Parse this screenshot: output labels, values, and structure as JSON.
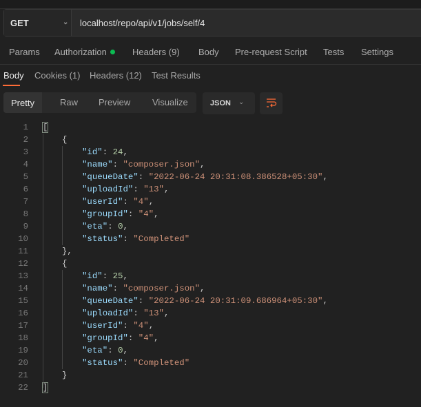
{
  "request": {
    "method": "GET",
    "url": "localhost/repo/api/v1/jobs/self/4"
  },
  "request_tabs": [
    {
      "label": "Params"
    },
    {
      "label": "Authorization",
      "indicator": "green-dot"
    },
    {
      "label": "Headers",
      "count": "(9)"
    },
    {
      "label": "Body"
    },
    {
      "label": "Pre-request Script"
    },
    {
      "label": "Tests"
    },
    {
      "label": "Settings"
    }
  ],
  "response_tabs": [
    {
      "label": "Body",
      "active": true
    },
    {
      "label": "Cookies",
      "count": "(1)"
    },
    {
      "label": "Headers",
      "count": "(12)"
    },
    {
      "label": "Test Results"
    }
  ],
  "view_modes": [
    "Pretty",
    "Raw",
    "Preview",
    "Visualize"
  ],
  "selected_view": "Pretty",
  "format": "JSON",
  "colors": {
    "accent": "#ff6c37",
    "count": "#2fbf6a",
    "key": "#9cdcfe",
    "string": "#ce9178",
    "number": "#b5cea8"
  },
  "icons": {
    "wrap": "word-wrap-icon",
    "dropdown": "chevron-down-icon"
  },
  "body_lines": [
    {
      "i": 0,
      "t": [
        [
          "p",
          "["
        ]
      ]
    },
    {
      "i": 1,
      "t": [
        [
          "p",
          "{"
        ]
      ]
    },
    {
      "i": 2,
      "t": [
        [
          "k",
          "\"id\""
        ],
        [
          "p",
          ": "
        ],
        [
          "n",
          "24"
        ],
        [
          "p",
          ","
        ]
      ]
    },
    {
      "i": 2,
      "t": [
        [
          "k",
          "\"name\""
        ],
        [
          "p",
          ": "
        ],
        [
          "s",
          "\"composer.json\""
        ],
        [
          "p",
          ","
        ]
      ]
    },
    {
      "i": 2,
      "t": [
        [
          "k",
          "\"queueDate\""
        ],
        [
          "p",
          ": "
        ],
        [
          "s",
          "\"2022-06-24 20:31:08.386528+05:30\""
        ],
        [
          "p",
          ","
        ]
      ]
    },
    {
      "i": 2,
      "t": [
        [
          "k",
          "\"uploadId\""
        ],
        [
          "p",
          ": "
        ],
        [
          "s",
          "\"13\""
        ],
        [
          "p",
          ","
        ]
      ]
    },
    {
      "i": 2,
      "t": [
        [
          "k",
          "\"userId\""
        ],
        [
          "p",
          ": "
        ],
        [
          "s",
          "\"4\""
        ],
        [
          "p",
          ","
        ]
      ]
    },
    {
      "i": 2,
      "t": [
        [
          "k",
          "\"groupId\""
        ],
        [
          "p",
          ": "
        ],
        [
          "s",
          "\"4\""
        ],
        [
          "p",
          ","
        ]
      ]
    },
    {
      "i": 2,
      "t": [
        [
          "k",
          "\"eta\""
        ],
        [
          "p",
          ": "
        ],
        [
          "n",
          "0"
        ],
        [
          "p",
          ","
        ]
      ]
    },
    {
      "i": 2,
      "t": [
        [
          "k",
          "\"status\""
        ],
        [
          "p",
          ": "
        ],
        [
          "s",
          "\"Completed\""
        ]
      ]
    },
    {
      "i": 1,
      "t": [
        [
          "p",
          "},"
        ]
      ]
    },
    {
      "i": 1,
      "t": [
        [
          "p",
          "{"
        ]
      ]
    },
    {
      "i": 2,
      "t": [
        [
          "k",
          "\"id\""
        ],
        [
          "p",
          ": "
        ],
        [
          "n",
          "25"
        ],
        [
          "p",
          ","
        ]
      ]
    },
    {
      "i": 2,
      "t": [
        [
          "k",
          "\"name\""
        ],
        [
          "p",
          ": "
        ],
        [
          "s",
          "\"composer.json\""
        ],
        [
          "p",
          ","
        ]
      ]
    },
    {
      "i": 2,
      "t": [
        [
          "k",
          "\"queueDate\""
        ],
        [
          "p",
          ": "
        ],
        [
          "s",
          "\"2022-06-24 20:31:09.686964+05:30\""
        ],
        [
          "p",
          ","
        ]
      ]
    },
    {
      "i": 2,
      "t": [
        [
          "k",
          "\"uploadId\""
        ],
        [
          "p",
          ": "
        ],
        [
          "s",
          "\"13\""
        ],
        [
          "p",
          ","
        ]
      ]
    },
    {
      "i": 2,
      "t": [
        [
          "k",
          "\"userId\""
        ],
        [
          "p",
          ": "
        ],
        [
          "s",
          "\"4\""
        ],
        [
          "p",
          ","
        ]
      ]
    },
    {
      "i": 2,
      "t": [
        [
          "k",
          "\"groupId\""
        ],
        [
          "p",
          ": "
        ],
        [
          "s",
          "\"4\""
        ],
        [
          "p",
          ","
        ]
      ]
    },
    {
      "i": 2,
      "t": [
        [
          "k",
          "\"eta\""
        ],
        [
          "p",
          ": "
        ],
        [
          "n",
          "0"
        ],
        [
          "p",
          ","
        ]
      ]
    },
    {
      "i": 2,
      "t": [
        [
          "k",
          "\"status\""
        ],
        [
          "p",
          ": "
        ],
        [
          "s",
          "\"Completed\""
        ]
      ]
    },
    {
      "i": 1,
      "t": [
        [
          "p",
          "}"
        ]
      ]
    },
    {
      "i": 0,
      "t": [
        [
          "p",
          "]"
        ]
      ]
    }
  ]
}
